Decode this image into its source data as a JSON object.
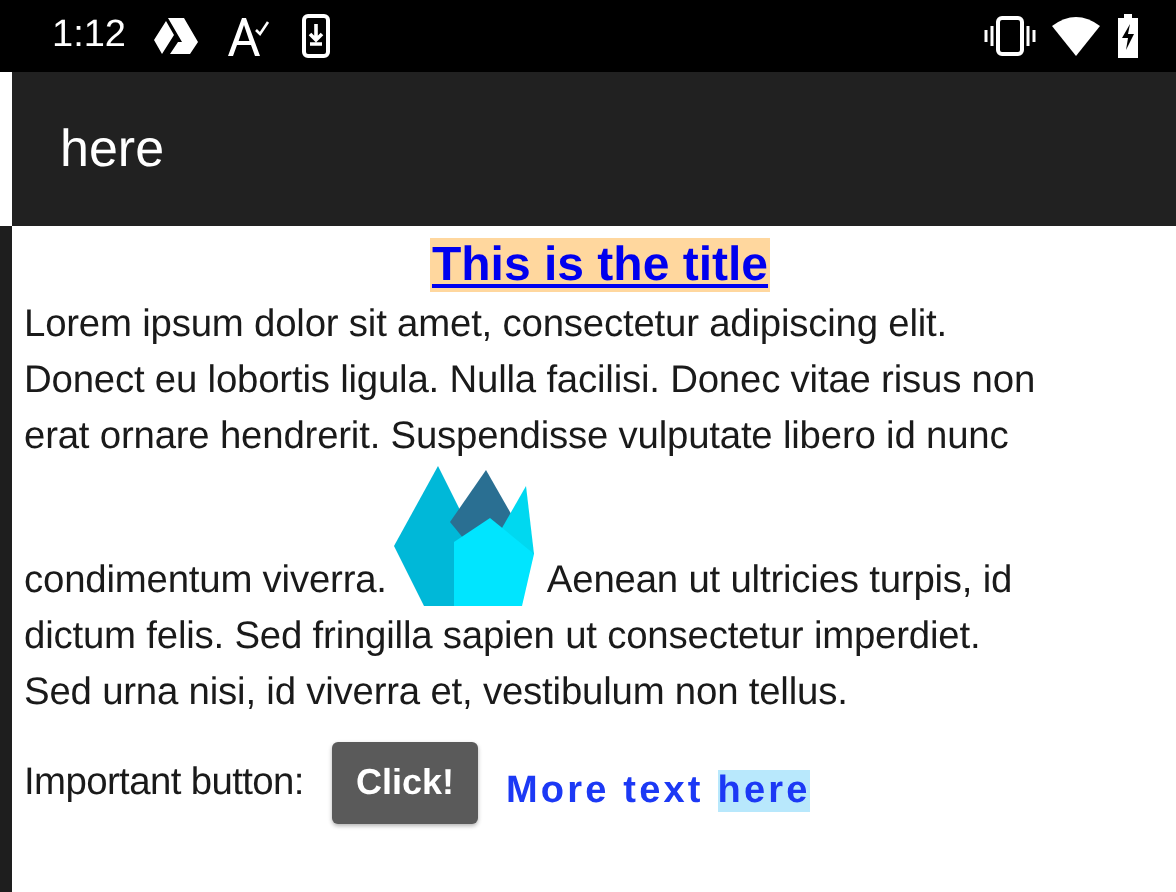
{
  "status_bar": {
    "time": "1:12"
  },
  "app_bar": {
    "title": "here"
  },
  "content": {
    "title": "This is the title",
    "lines_before": [
      "Lorem ipsum dolor sit amet, consectetur adipiscing elit.",
      "Donect eu lobortis ligula. Nulla facilisi. Donec vitae risus non",
      "erat ornare hendrerit. Suspendisse vulputate libero id nunc"
    ],
    "logo_line": {
      "before": "condimentum viverra.",
      "after": "Aenean ut ultricies turpis, id"
    },
    "lines_after": [
      "dictum felis. Sed fringilla sapien ut consectetur imperdiet.",
      "Sed urna nisi, id viverra et, vestibulum non tellus."
    ],
    "button_row": {
      "label": "Important button:",
      "button": "Click!",
      "link": "More text ",
      "link_highlighted": "here"
    }
  }
}
